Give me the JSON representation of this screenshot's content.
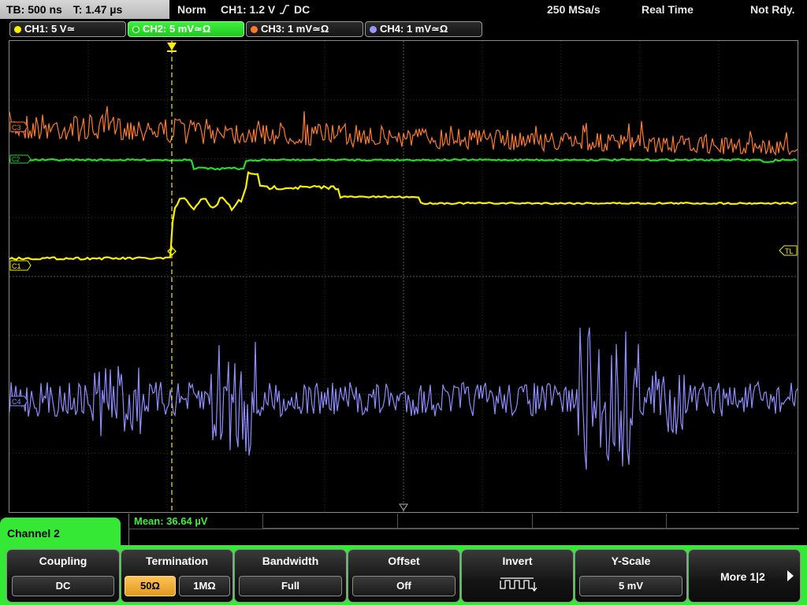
{
  "status_bar": {
    "timebase": "TB: 500 ns",
    "trigger_time": "T: 1.47 µs",
    "trigger_mode": "Norm",
    "trigger_source": "CH1: 1.2 V",
    "trigger_coupling": "DC",
    "sample_rate": "250 MSa/s",
    "acq_mode": "Real Time",
    "ready_state": "Not Rdy."
  },
  "channel_chips": [
    {
      "label": "CH1: 5 V≃",
      "color": "#f8f000"
    },
    {
      "label": "CH2: 5 mV≃Ω",
      "color": "#3ef03e"
    },
    {
      "label": "CH3: 1 mV≃Ω",
      "color": "#ff7a2a"
    },
    {
      "label": "CH4: 1 mV≃Ω",
      "color": "#9a96ff"
    }
  ],
  "screen": {
    "trace_colors": {
      "ch1": "#f8f000",
      "ch2": "#22dd22",
      "ch3": "#ff7a2a",
      "ch4": "#8f8cff"
    },
    "markers": {
      "ch1": "C1",
      "ch2": "C2",
      "ch3": "C3",
      "ch4": "C4",
      "trigger_level": "TL"
    }
  },
  "measurement": {
    "text": "Mean: 36.64 µV"
  },
  "menu": {
    "title": "Channel 2",
    "coupling": {
      "label": "Coupling",
      "value": "DC"
    },
    "termination": {
      "label": "Termination",
      "options": [
        "50Ω",
        "1MΩ"
      ],
      "selected": "50Ω"
    },
    "bandwidth": {
      "label": "Bandwidth",
      "value": "Full"
    },
    "offset": {
      "label": "Offset",
      "value": "Off"
    },
    "invert": {
      "label": "Invert",
      "icon": "inverted-square-wave-icon"
    },
    "y_scale": {
      "label": "Y-Scale",
      "value": "5 mV"
    },
    "more": {
      "label": "More 1|2"
    }
  }
}
